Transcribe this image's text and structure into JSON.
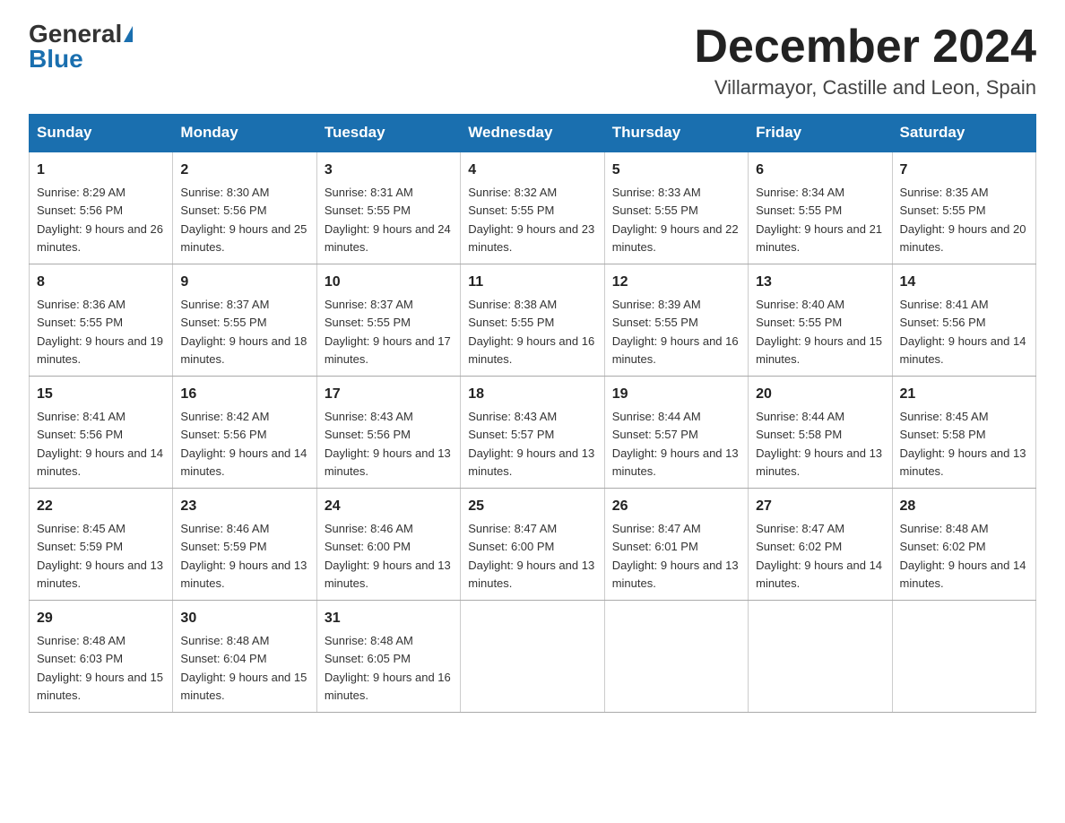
{
  "header": {
    "logo_general": "General",
    "logo_blue": "Blue",
    "month_title": "December 2024",
    "location": "Villarmayor, Castille and Leon, Spain"
  },
  "days_of_week": [
    "Sunday",
    "Monday",
    "Tuesday",
    "Wednesday",
    "Thursday",
    "Friday",
    "Saturday"
  ],
  "weeks": [
    [
      {
        "day": "1",
        "sunrise": "8:29 AM",
        "sunset": "5:56 PM",
        "daylight": "9 hours and 26 minutes."
      },
      {
        "day": "2",
        "sunrise": "8:30 AM",
        "sunset": "5:56 PM",
        "daylight": "9 hours and 25 minutes."
      },
      {
        "day": "3",
        "sunrise": "8:31 AM",
        "sunset": "5:55 PM",
        "daylight": "9 hours and 24 minutes."
      },
      {
        "day": "4",
        "sunrise": "8:32 AM",
        "sunset": "5:55 PM",
        "daylight": "9 hours and 23 minutes."
      },
      {
        "day": "5",
        "sunrise": "8:33 AM",
        "sunset": "5:55 PM",
        "daylight": "9 hours and 22 minutes."
      },
      {
        "day": "6",
        "sunrise": "8:34 AM",
        "sunset": "5:55 PM",
        "daylight": "9 hours and 21 minutes."
      },
      {
        "day": "7",
        "sunrise": "8:35 AM",
        "sunset": "5:55 PM",
        "daylight": "9 hours and 20 minutes."
      }
    ],
    [
      {
        "day": "8",
        "sunrise": "8:36 AM",
        "sunset": "5:55 PM",
        "daylight": "9 hours and 19 minutes."
      },
      {
        "day": "9",
        "sunrise": "8:37 AM",
        "sunset": "5:55 PM",
        "daylight": "9 hours and 18 minutes."
      },
      {
        "day": "10",
        "sunrise": "8:37 AM",
        "sunset": "5:55 PM",
        "daylight": "9 hours and 17 minutes."
      },
      {
        "day": "11",
        "sunrise": "8:38 AM",
        "sunset": "5:55 PM",
        "daylight": "9 hours and 16 minutes."
      },
      {
        "day": "12",
        "sunrise": "8:39 AM",
        "sunset": "5:55 PM",
        "daylight": "9 hours and 16 minutes."
      },
      {
        "day": "13",
        "sunrise": "8:40 AM",
        "sunset": "5:55 PM",
        "daylight": "9 hours and 15 minutes."
      },
      {
        "day": "14",
        "sunrise": "8:41 AM",
        "sunset": "5:56 PM",
        "daylight": "9 hours and 14 minutes."
      }
    ],
    [
      {
        "day": "15",
        "sunrise": "8:41 AM",
        "sunset": "5:56 PM",
        "daylight": "9 hours and 14 minutes."
      },
      {
        "day": "16",
        "sunrise": "8:42 AM",
        "sunset": "5:56 PM",
        "daylight": "9 hours and 14 minutes."
      },
      {
        "day": "17",
        "sunrise": "8:43 AM",
        "sunset": "5:56 PM",
        "daylight": "9 hours and 13 minutes."
      },
      {
        "day": "18",
        "sunrise": "8:43 AM",
        "sunset": "5:57 PM",
        "daylight": "9 hours and 13 minutes."
      },
      {
        "day": "19",
        "sunrise": "8:44 AM",
        "sunset": "5:57 PM",
        "daylight": "9 hours and 13 minutes."
      },
      {
        "day": "20",
        "sunrise": "8:44 AM",
        "sunset": "5:58 PM",
        "daylight": "9 hours and 13 minutes."
      },
      {
        "day": "21",
        "sunrise": "8:45 AM",
        "sunset": "5:58 PM",
        "daylight": "9 hours and 13 minutes."
      }
    ],
    [
      {
        "day": "22",
        "sunrise": "8:45 AM",
        "sunset": "5:59 PM",
        "daylight": "9 hours and 13 minutes."
      },
      {
        "day": "23",
        "sunrise": "8:46 AM",
        "sunset": "5:59 PM",
        "daylight": "9 hours and 13 minutes."
      },
      {
        "day": "24",
        "sunrise": "8:46 AM",
        "sunset": "6:00 PM",
        "daylight": "9 hours and 13 minutes."
      },
      {
        "day": "25",
        "sunrise": "8:47 AM",
        "sunset": "6:00 PM",
        "daylight": "9 hours and 13 minutes."
      },
      {
        "day": "26",
        "sunrise": "8:47 AM",
        "sunset": "6:01 PM",
        "daylight": "9 hours and 13 minutes."
      },
      {
        "day": "27",
        "sunrise": "8:47 AM",
        "sunset": "6:02 PM",
        "daylight": "9 hours and 14 minutes."
      },
      {
        "day": "28",
        "sunrise": "8:48 AM",
        "sunset": "6:02 PM",
        "daylight": "9 hours and 14 minutes."
      }
    ],
    [
      {
        "day": "29",
        "sunrise": "8:48 AM",
        "sunset": "6:03 PM",
        "daylight": "9 hours and 15 minutes."
      },
      {
        "day": "30",
        "sunrise": "8:48 AM",
        "sunset": "6:04 PM",
        "daylight": "9 hours and 15 minutes."
      },
      {
        "day": "31",
        "sunrise": "8:48 AM",
        "sunset": "6:05 PM",
        "daylight": "9 hours and 16 minutes."
      },
      null,
      null,
      null,
      null
    ]
  ]
}
